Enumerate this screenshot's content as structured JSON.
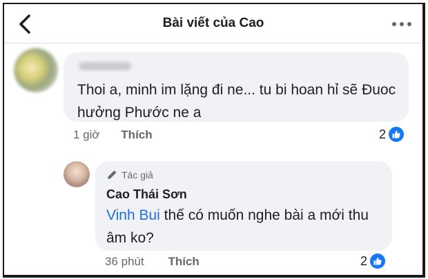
{
  "header": {
    "title": "Bài viết của Cao",
    "back_icon": "chevron-left-icon",
    "more_icon": "more-horizontal-icon"
  },
  "comments": [
    {
      "author": "",
      "text": "Thoi a, minh im lặng đi ne... tu bi hoan hỉ sẽ Đuoc hưởng Phước ne a",
      "time": "1 giờ",
      "like_label": "Thích",
      "reaction_count": "2"
    },
    {
      "badge": "Tác giả",
      "author": "Cao Thái Sơn",
      "mention": "Vinh Bui",
      "text": " thế có muốn nghe bài a mới thu âm ko?",
      "time": "36 phút",
      "like_label": "Thích",
      "reaction_count": "2"
    }
  ],
  "colors": {
    "accent": "#1877f2",
    "bubble": "#f0f2f5",
    "muted_text": "#65676b",
    "mention": "#216fdb"
  }
}
